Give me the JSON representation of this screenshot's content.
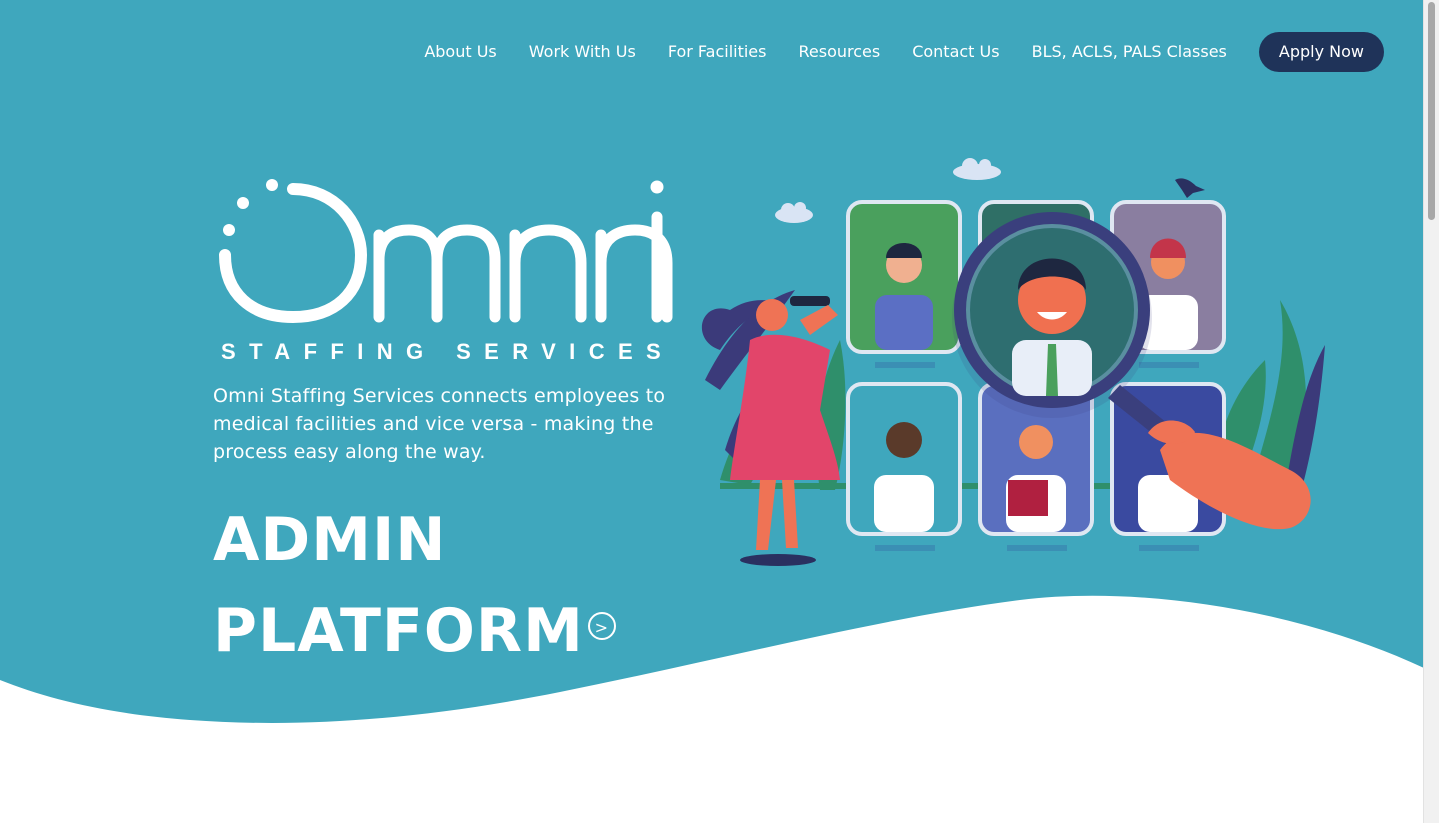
{
  "nav": {
    "items": [
      {
        "label": "About Us"
      },
      {
        "label": "Work With Us"
      },
      {
        "label": "For Facilities"
      },
      {
        "label": "Resources"
      },
      {
        "label": "Contact Us"
      },
      {
        "label": "BLS, ACLS, PALS Classes"
      }
    ],
    "apply_label": "Apply Now"
  },
  "logo": {
    "wordmark": "Omni",
    "subtitle": "STAFFING SERVICES"
  },
  "hero": {
    "tagline": "Omni Staffing Services connects employees to medical facilities and vice versa - making the process easy along the way.",
    "cta_line1": "ADMIN",
    "cta_line2": "PLATFORM",
    "cta_icon": ">"
  },
  "colors": {
    "hero_bg": "#3fa7bd",
    "apply_bg": "#1f3359",
    "text": "#ffffff"
  }
}
